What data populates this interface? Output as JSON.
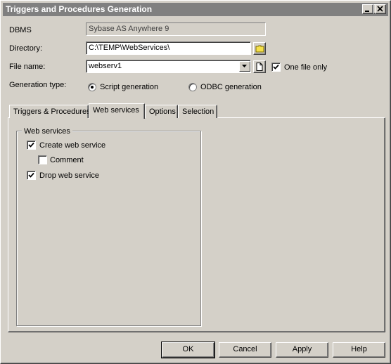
{
  "window": {
    "title": "Triggers and Procedures Generation"
  },
  "form": {
    "dbms_label": "DBMS",
    "dbms_value": "Sybase AS Anywhere 9",
    "directory_label": "Directory:",
    "directory_value": "C:\\TEMP\\WebServices\\",
    "filename_label": "File name:",
    "filename_value": "webserv1",
    "one_file_only_label": "One file only",
    "one_file_only_checked": true,
    "generation_type_label": "Generation type:",
    "script_generation_label": "Script generation",
    "odbc_generation_label": "ODBC generation",
    "selected_generation_type": "Script generation"
  },
  "tabs": [
    {
      "label": "Triggers & Procedures",
      "active": false
    },
    {
      "label": "Web services",
      "active": true
    },
    {
      "label": "Options",
      "active": false
    },
    {
      "label": "Selection",
      "active": false
    }
  ],
  "web_services": {
    "group_label": "Web services",
    "create_label": "Create web service",
    "create_checked": true,
    "comment_label": "Comment",
    "comment_checked": false,
    "drop_label": "Drop web service",
    "drop_checked": true
  },
  "buttons": {
    "ok": "OK",
    "cancel": "Cancel",
    "apply": "Apply",
    "help": "Help"
  },
  "icons": {
    "minimize": "minimize-icon",
    "maximize": "maximize-icon",
    "close": "close-icon",
    "folder": "folder-icon",
    "dropdown": "chevron-down-icon",
    "new_file": "new-file-icon",
    "checkmark": "checkmark-icon"
  },
  "colors": {
    "titlebar": "#808080",
    "face": "#d4d0c8"
  }
}
